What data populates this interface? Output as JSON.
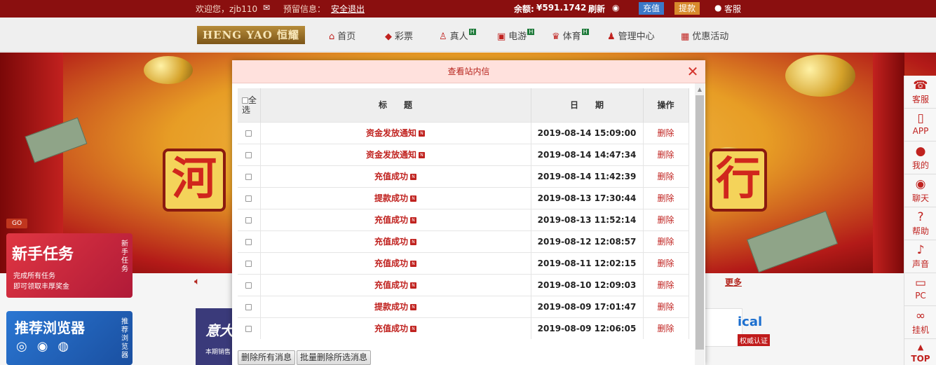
{
  "topbar": {
    "welcome": "欢迎您，zjb110",
    "reserve_label": "预留信息：",
    "logout": "安全退出",
    "balance_label": "余额:",
    "balance_value": "¥591.1742",
    "refresh": "刷新",
    "recharge": "充值",
    "withdraw": "提款",
    "service": "客服"
  },
  "nav": {
    "logo": "HENG YAO 恒耀",
    "items": [
      {
        "label": "首页",
        "icon": "home-icon"
      },
      {
        "label": "彩票",
        "icon": "diamond-icon"
      },
      {
        "label": "真人",
        "icon": "person-icon",
        "badge": "hot"
      },
      {
        "label": "电游",
        "icon": "game-icon",
        "badge": "hot"
      },
      {
        "label": "体育",
        "icon": "trophy-icon",
        "badge": "hot"
      },
      {
        "label": "管理中心",
        "icon": "people-icon"
      },
      {
        "label": "优惠活动",
        "icon": "gift-icon"
      }
    ]
  },
  "banner": {
    "left_char": "河",
    "right_char": "行",
    "promo_title": "新手任务",
    "promo_line1": "完成所有任务",
    "promo_line2": "即可领取丰厚奖金",
    "promo_side": "新手任务",
    "go_tag": "GO",
    "browser_title": "推荐浏览器",
    "browser_side": "推荐浏览器",
    "dark_card_title": "意大",
    "dark_card_sub": "本期销售",
    "cert_text": "ical",
    "cert_badge": "权威认证",
    "more": "更多"
  },
  "sidebar": {
    "items": [
      {
        "label": "客服",
        "icon": "headset-icon",
        "glyph": "☎"
      },
      {
        "label": "APP",
        "icon": "phone-icon",
        "glyph": "▯"
      },
      {
        "label": "我的",
        "icon": "user-icon",
        "glyph": "●"
      },
      {
        "label": "聊天",
        "icon": "chat-icon",
        "glyph": "◉"
      },
      {
        "label": "帮助",
        "icon": "help-icon",
        "glyph": "?"
      },
      {
        "label": "声音",
        "icon": "speaker-icon",
        "glyph": "♪"
      },
      {
        "label": "PC",
        "icon": "monitor-icon",
        "glyph": "▭"
      },
      {
        "label": "挂机",
        "icon": "robot-icon",
        "glyph": "∞"
      },
      {
        "label": "TOP",
        "icon": "arrow-up-icon",
        "glyph": "▲"
      }
    ]
  },
  "modal": {
    "title": "查看站内信",
    "close": "✕",
    "headers": {
      "select_all": "全选",
      "title": "标　　题",
      "date": "日　　期",
      "op": "操作"
    },
    "rows": [
      {
        "title": "资金发放通知",
        "date": "2019-08-14 15:09:00",
        "op": "删除"
      },
      {
        "title": "资金发放通知",
        "date": "2019-08-14 14:47:34",
        "op": "删除"
      },
      {
        "title": "充值成功",
        "date": "2019-08-14 11:42:39",
        "op": "删除"
      },
      {
        "title": "提款成功",
        "date": "2019-08-13 17:30:44",
        "op": "删除"
      },
      {
        "title": "充值成功",
        "date": "2019-08-13 11:52:14",
        "op": "删除"
      },
      {
        "title": "充值成功",
        "date": "2019-08-12 12:08:57",
        "op": "删除"
      },
      {
        "title": "充值成功",
        "date": "2019-08-11 12:02:15",
        "op": "删除"
      },
      {
        "title": "充值成功",
        "date": "2019-08-10 12:09:03",
        "op": "删除"
      },
      {
        "title": "提款成功",
        "date": "2019-08-09 17:01:47",
        "op": "删除"
      },
      {
        "title": "充值成功",
        "date": "2019-08-09 12:06:05",
        "op": "删除"
      }
    ],
    "new_badge": "N",
    "delete_all": "删除所有消息",
    "delete_selected": "批量删除所选消息"
  },
  "colors": {
    "brand_red": "#c0221f",
    "topbar_bg": "#8a0f0f",
    "modal_header_bg": "#ffe1dd",
    "recharge_blue": "#3b78c8",
    "withdraw_orange": "#d88a2c"
  }
}
